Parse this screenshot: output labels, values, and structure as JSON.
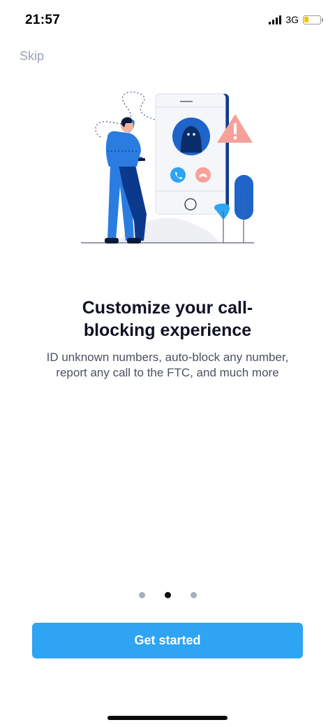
{
  "status_bar": {
    "time": "21:57",
    "network": "3G",
    "battery_level": 0.3,
    "battery_color": "#f5c400"
  },
  "skip_label": "Skip",
  "headline": "Customize your call-blocking experience",
  "headline_line1": "Customize your call-",
  "headline_line2": "blocking experience",
  "subtitle_line1": "ID unknown numbers, auto-block any number,",
  "subtitle_line2": "report any call to the FTC, and much more",
  "pager": {
    "total": 3,
    "active_index": 1
  },
  "cta_label": "Get started",
  "colors": {
    "accent": "#2ea4f3",
    "skip": "#9aa3b7",
    "warning": "#f7a09a",
    "figure_blue": "#2a7ce0",
    "navy": "#0b3a8c"
  },
  "icons": {
    "signal": "cellular-signal-icon",
    "battery": "battery-icon",
    "warning": "warning-triangle-icon",
    "accept_call": "phone-accept-icon",
    "decline_call": "phone-decline-icon"
  }
}
